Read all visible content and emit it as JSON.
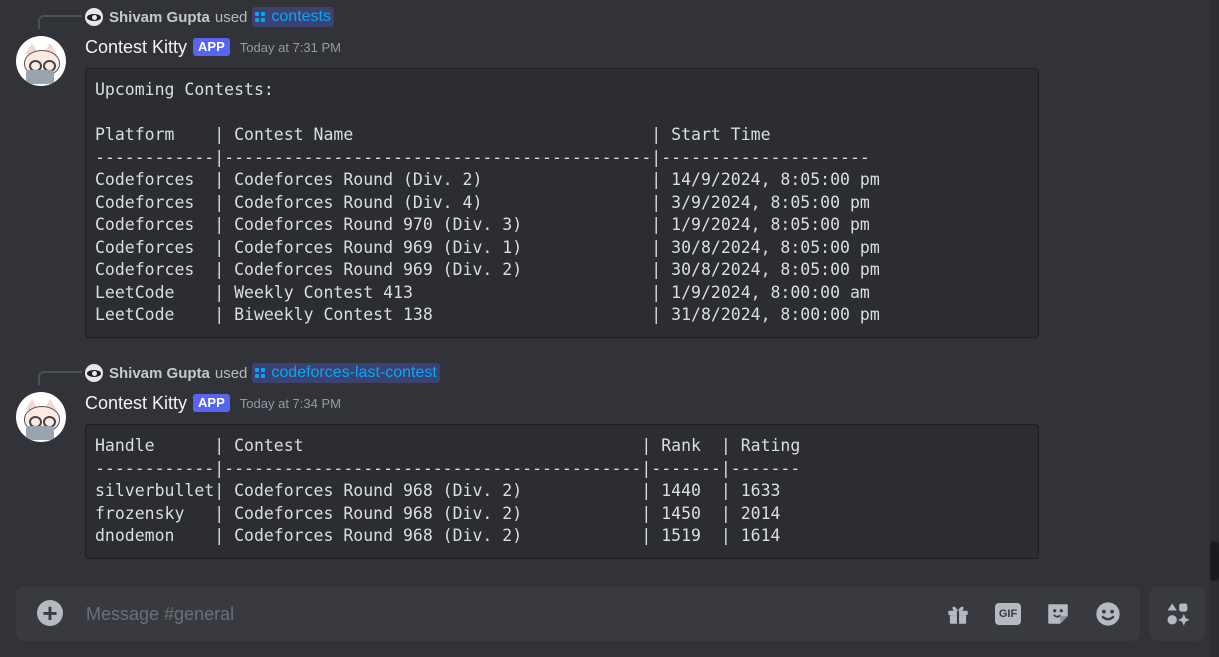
{
  "messages": [
    {
      "reply_user": "Shivam Gupta",
      "used_text": "used",
      "command": "contests",
      "bot_name": "Contest Kitty",
      "badge": "APP",
      "timestamp": "Today at 7:31 PM",
      "code": "Upcoming Contests:\n\nPlatform    | Contest Name                              | Start Time\n------------|-------------------------------------------|---------------------\nCodeforces  | Codeforces Round (Div. 2)                 | 14/9/2024, 8:05:00 pm\nCodeforces  | Codeforces Round (Div. 4)                 | 3/9/2024, 8:05:00 pm\nCodeforces  | Codeforces Round 970 (Div. 3)             | 1/9/2024, 8:05:00 pm\nCodeforces  | Codeforces Round 969 (Div. 1)             | 30/8/2024, 8:05:00 pm\nCodeforces  | Codeforces Round 969 (Div. 2)             | 30/8/2024, 8:05:00 pm\nLeetCode    | Weekly Contest 413                        | 1/9/2024, 8:00:00 am\nLeetCode    | Biweekly Contest 138                      | 31/8/2024, 8:00:00 pm"
    },
    {
      "reply_user": "Shivam Gupta",
      "used_text": "used",
      "command": "codeforces-last-contest",
      "bot_name": "Contest Kitty",
      "badge": "APP",
      "timestamp": "Today at 7:34 PM",
      "code": "Handle      | Contest                                  | Rank  | Rating\n------------|------------------------------------------|-------|-------\nsilverbullet| Codeforces Round 968 (Div. 2)            | 1440  | 1633\nfrozensky   | Codeforces Round 968 (Div. 2)            | 1450  | 2014\ndnodemon    | Codeforces Round 968 (Div. 2)            | 1519  | 1614"
    }
  ],
  "composer": {
    "placeholder": "Message #general",
    "icons": [
      "plus-circle-icon",
      "gift-icon",
      "gif-icon",
      "sticker-icon",
      "emoji-icon",
      "app-launcher-icon"
    ],
    "gif_label": "GIF"
  },
  "colors": {
    "background": "#313338",
    "codeblock": "#2b2d31",
    "app_badge": "#5865f2",
    "command_link": "#00a8fc"
  }
}
